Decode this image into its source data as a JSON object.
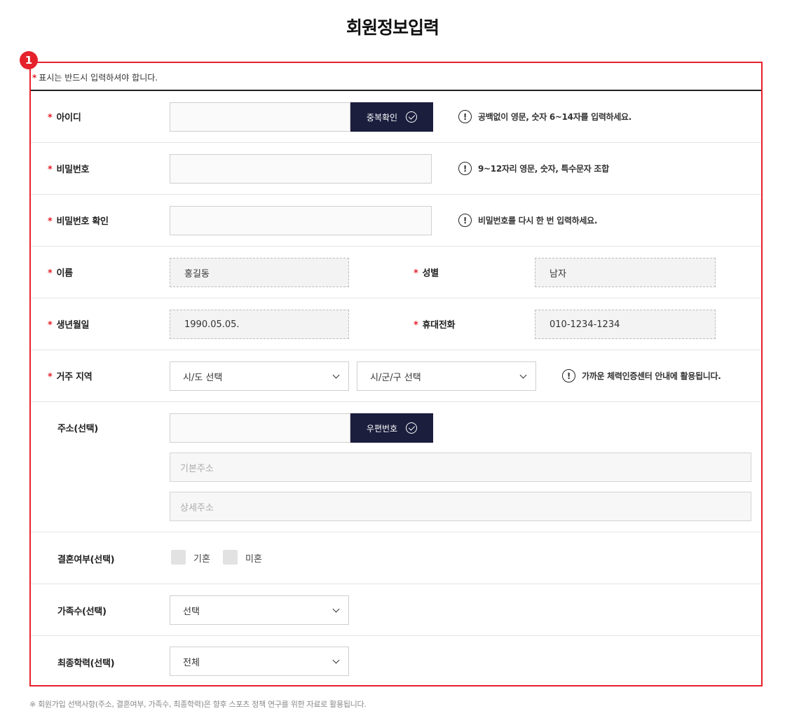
{
  "page_title": "회원정보입력",
  "badge": "1",
  "required_note": {
    "star": "*",
    "text": "표시는 반드시 입력하셔야 합니다."
  },
  "required_star": "*",
  "info_glyph": "!",
  "fields": {
    "user_id": {
      "label": "아이디",
      "value": "",
      "button": "중복확인",
      "hint": "공백없이 영문, 숫자 6~14자를 입력하세요."
    },
    "password": {
      "label": "비밀번호",
      "value": "",
      "hint": "9~12자리 영문, 숫자, 특수문자 조합"
    },
    "password_confirm": {
      "label": "비밀번호 확인",
      "value": "",
      "hint": "비밀번호를 다시 한 번 입력하세요."
    },
    "name": {
      "label": "이름",
      "value": "홍길동"
    },
    "gender": {
      "label": "성별",
      "value": "남자"
    },
    "birthdate": {
      "label": "생년월일",
      "value": "1990.05.05."
    },
    "phone": {
      "label": "휴대전화",
      "value": "010-1234-1234"
    },
    "region": {
      "label": "거주 지역",
      "sido": "시/도 선택",
      "sigungu": "시/군/구 선택",
      "hint": "가까운 체력인증센터 안내에 활용됩니다."
    },
    "address": {
      "label": "주소(선택)",
      "zipcode": "",
      "button": "우편번호",
      "base_placeholder": "기본주소",
      "detail_placeholder": "상세주소"
    },
    "marital": {
      "label": "결혼여부(선택)",
      "options": [
        "기혼",
        "미혼"
      ]
    },
    "family": {
      "label": "가족수(선택)",
      "value": "선택"
    },
    "education": {
      "label": "최종학력(선택)",
      "value": "전체"
    }
  },
  "footnote": "※ 회원가입 선택사항(주소, 결혼여부, 가족수, 최종학력)은 향후 스포츠 정책 연구를 위한 자료로 활용됩니다."
}
